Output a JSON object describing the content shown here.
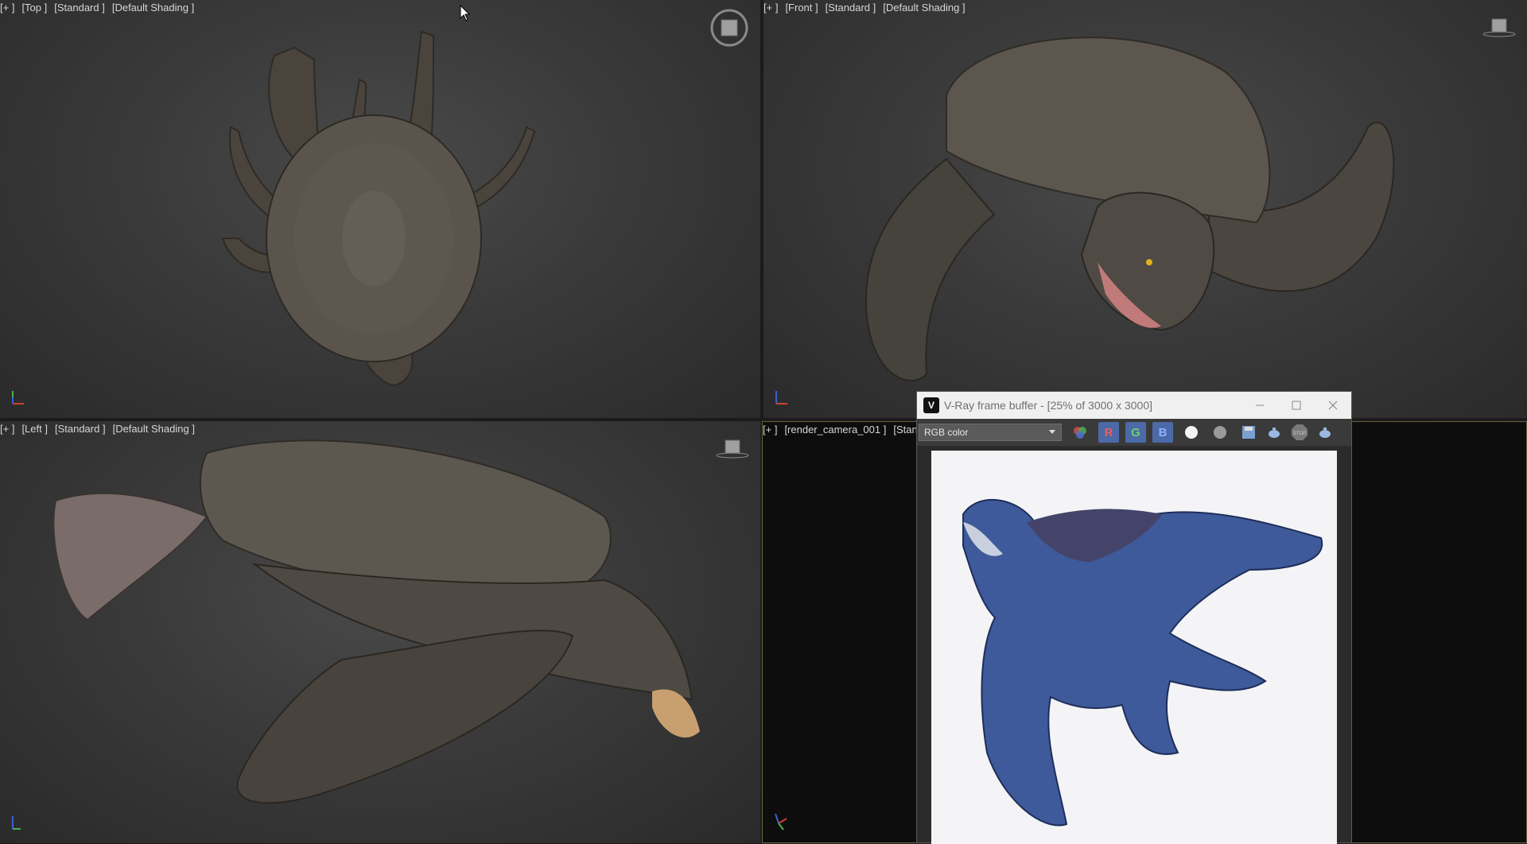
{
  "viewports": {
    "top": {
      "plus": "[+ ]",
      "view": "[Top ]",
      "shading": "[Standard ]",
      "mode": "[Default Shading ]"
    },
    "front": {
      "plus": "[+ ]",
      "view": "[Front ]",
      "shading": "[Standard ]",
      "mode": "[Default Shading ]"
    },
    "left": {
      "plus": "[+ ]",
      "view": "[Left ]",
      "shading": "[Standard ]",
      "mode": "[Default Shading ]"
    },
    "camera": {
      "plus": "[+ ]",
      "view": "[render_camera_001 ]",
      "shading": "[Stan"
    }
  },
  "vfb": {
    "title": "V-Ray frame buffer - [25% of 3000 x 3000]",
    "channel": "RGB color",
    "r_label": "R",
    "g_label": "G",
    "b_label": "B",
    "stop_label": "STOP"
  },
  "icons": [
    "cursor-icon",
    "viewcube-icon",
    "axis-tripod-icon",
    "vray-logo-icon",
    "minimize-icon",
    "maximize-icon",
    "close-icon",
    "chevron-down-icon",
    "color-channels-icon",
    "white-dot-icon",
    "gray-dot-icon",
    "save-icon",
    "teapot-render-icon",
    "stop-icon"
  ],
  "colors": {
    "viewport_bg": "#3a3a3a",
    "camera_border": "#6b6040",
    "accent_rgb": "#4b6aa7"
  }
}
